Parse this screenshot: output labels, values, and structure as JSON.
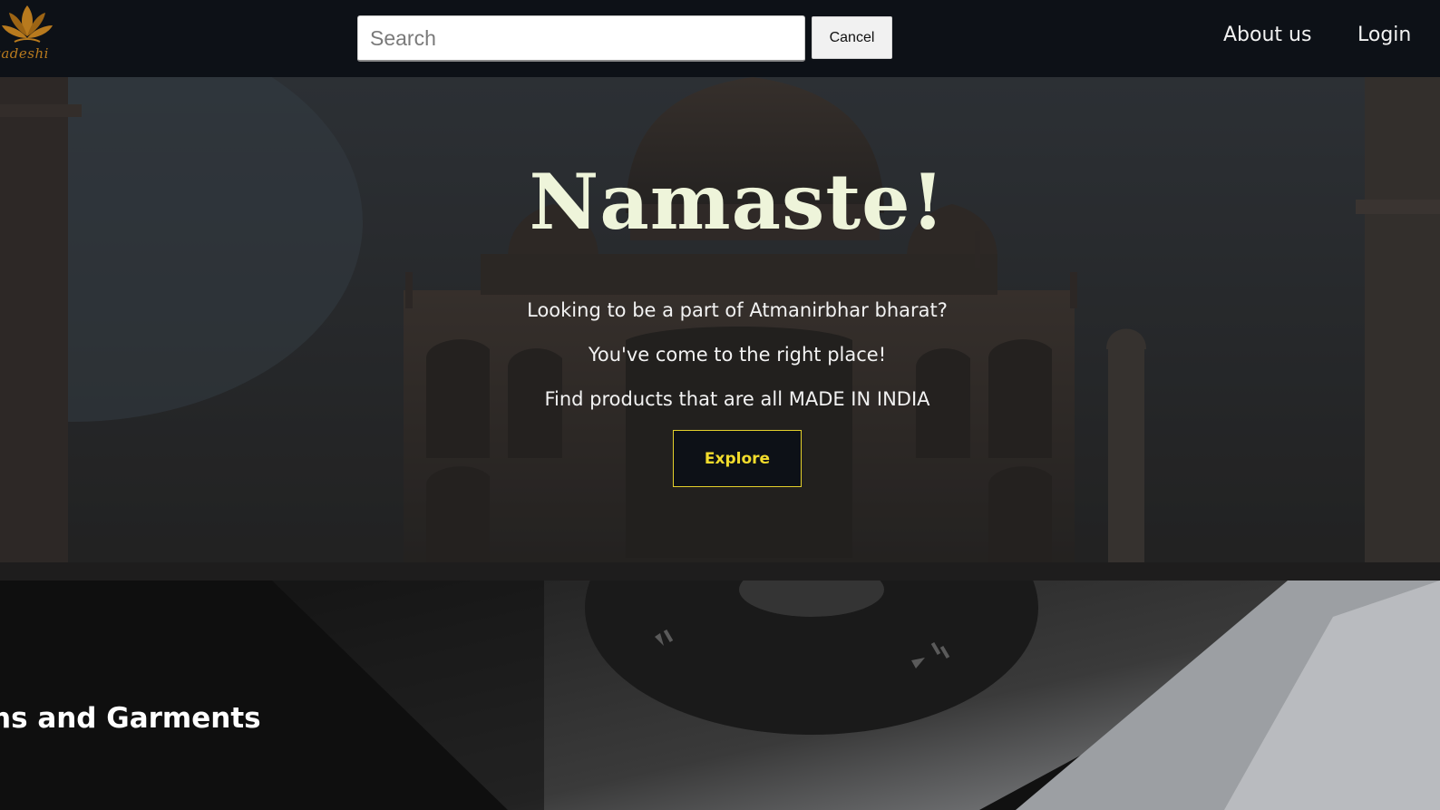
{
  "brand": {
    "logo_text": "wadeshi",
    "accent_color": "#b87a1e"
  },
  "search": {
    "placeholder": "Search",
    "value": "",
    "cancel_label": "Cancel"
  },
  "nav": {
    "about_label": "About us",
    "login_label": "Login"
  },
  "hero": {
    "title": "Namaste!",
    "line1": "Looking to be a part of Atmanirbhar bharat?",
    "line2": "You've come to the right place!",
    "line3": "Find products that are all MADE IN INDIA",
    "explore_label": "Explore",
    "explore_color": "#f2dc2c"
  },
  "category": {
    "title": "hs and Garments"
  }
}
